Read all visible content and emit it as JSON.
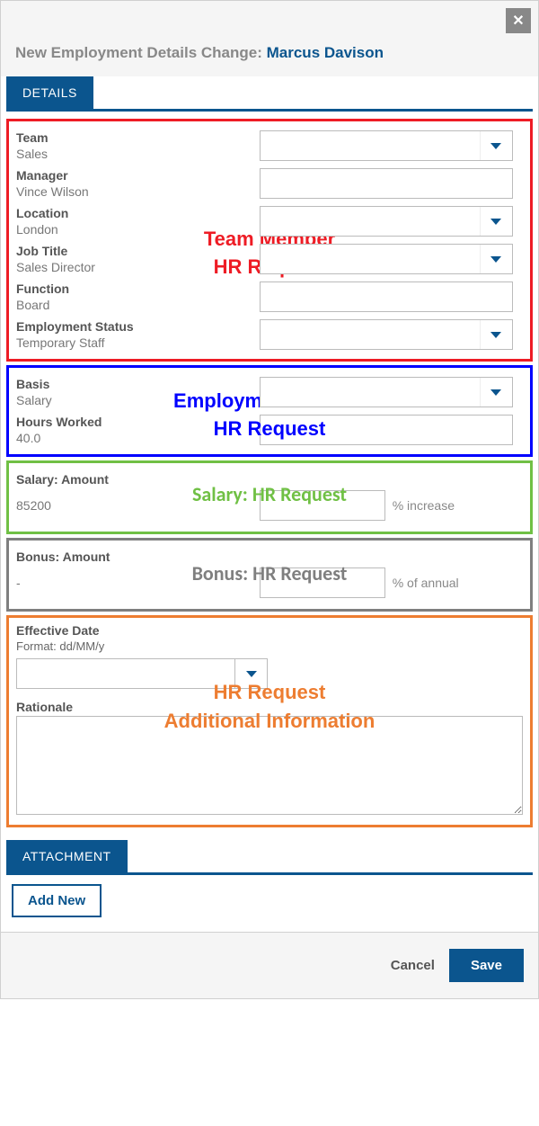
{
  "header": {
    "prefix": "New Employment Details Change: ",
    "name": "Marcus Davison"
  },
  "tabs": {
    "details": "DETAILS",
    "attachment": "ATTACHMENT"
  },
  "teamMember": {
    "overlay_line1": "Team Member",
    "overlay_line2": "HR Request",
    "team_label": "Team",
    "team_value": "Sales",
    "manager_label": "Manager",
    "manager_value": "Vince Wilson",
    "location_label": "Location",
    "location_value": "London",
    "jobtitle_label": "Job Title",
    "jobtitle_value": "Sales Director",
    "function_label": "Function",
    "function_value": "Board",
    "empstatus_label": "Employment Status",
    "empstatus_value": "Temporary Staff"
  },
  "employment": {
    "overlay_line1": "Employment Record",
    "overlay_line2": "HR Request",
    "basis_label": "Basis",
    "basis_value": "Salary",
    "hours_label": "Hours Worked",
    "hours_value": "40.0"
  },
  "salary": {
    "overlay": "Salary: HR Request",
    "label": "Salary: Amount",
    "value": "85200",
    "suffix": "% increase"
  },
  "bonus": {
    "overlay": "Bonus: HR Request",
    "label": "Bonus: Amount",
    "value": "-",
    "suffix": "% of annual"
  },
  "effective": {
    "overlay_line1": "HR Request",
    "overlay_line2": "Additional Information",
    "date_label": "Effective Date",
    "format_hint": "Format: dd/MM/y",
    "rationale_label": "Rationale"
  },
  "buttons": {
    "add_new": "Add New",
    "cancel": "Cancel",
    "save": "Save"
  }
}
